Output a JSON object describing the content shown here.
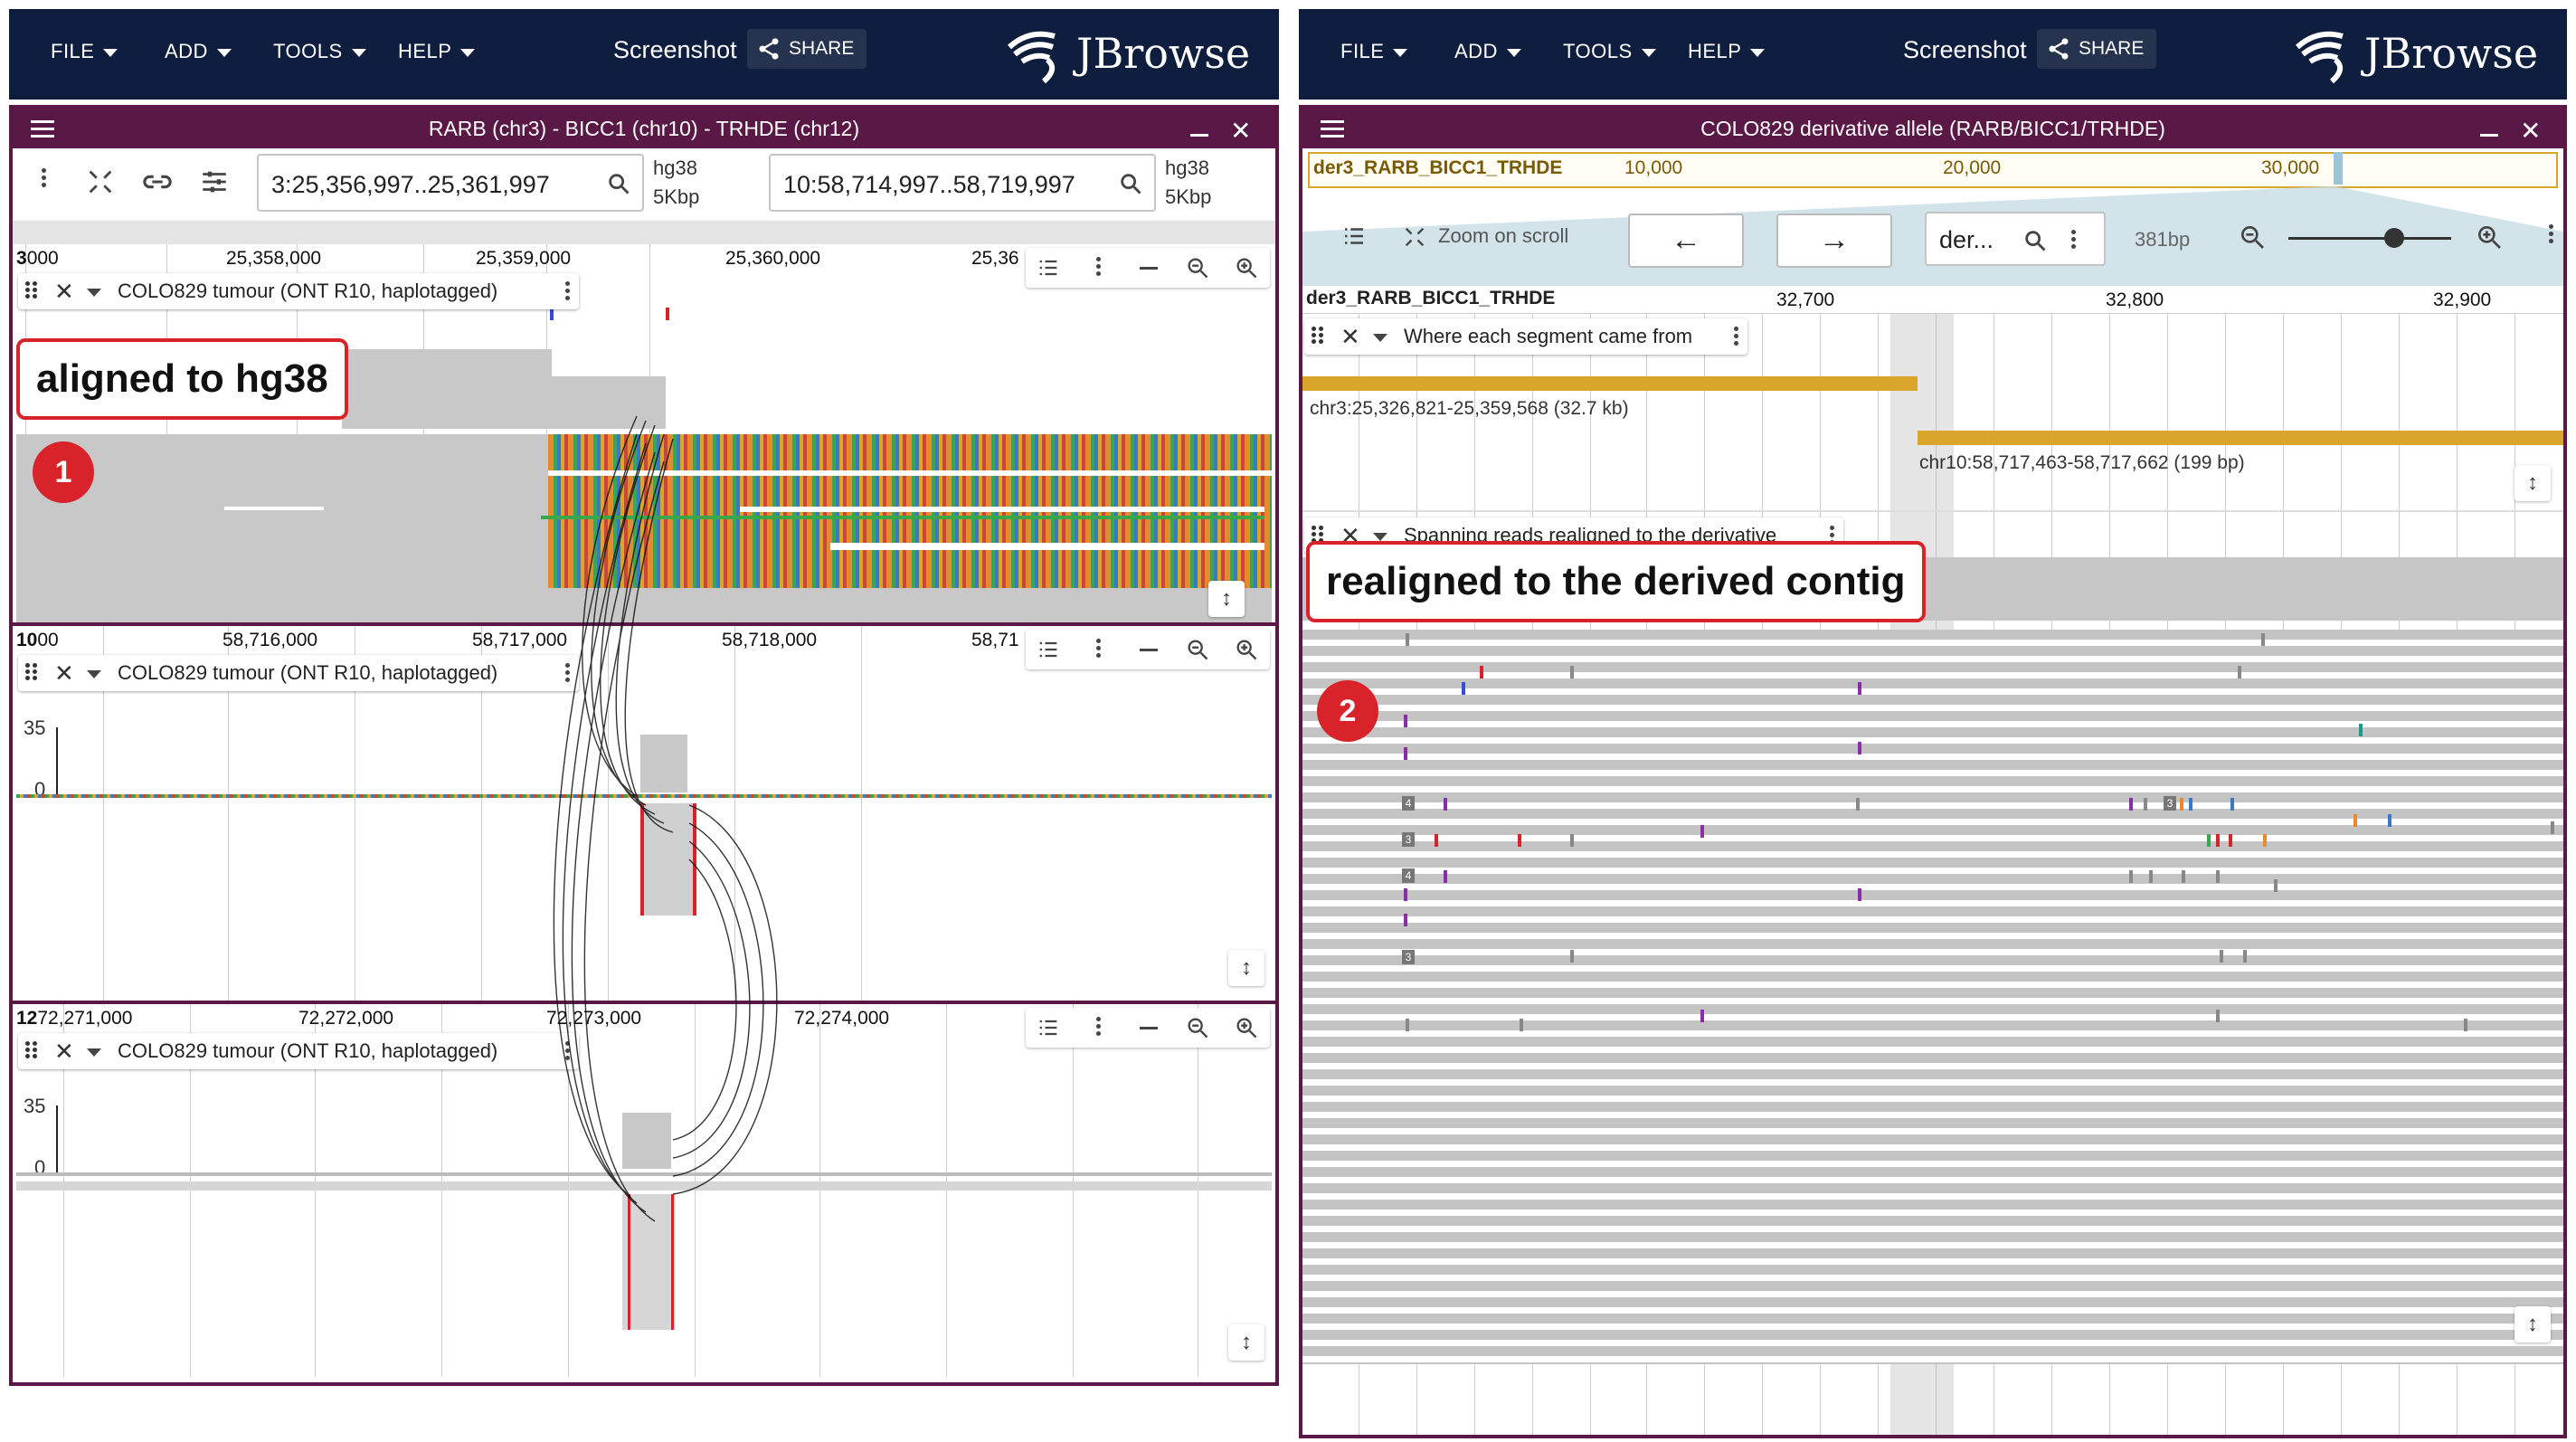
{
  "left_app": {
    "menu": [
      "FILE",
      "ADD",
      "TOOLS",
      "HELP"
    ],
    "screenshot_label": "Screenshot",
    "share_label": "SHARE",
    "logo_text": "JBrowse",
    "view_title": "RARB (chr3) - BICC1 (chr10) - TRHDE (chr12)",
    "location1": "3:25,356,997..25,361,997",
    "location2": "10:58,714,997..58,719,997",
    "assembly1": "hg38",
    "span1": "5Kbp",
    "assembly2": "hg38",
    "span2": "5Kbp",
    "panel1": {
      "ref_prefix": "3",
      "ref_first": "000",
      "ticks": [
        "25,358,000",
        "25,359,000",
        "25,360,000",
        "25,36"
      ]
    },
    "panel2": {
      "ref_prefix": "10",
      "ref_first": "00",
      "ticks": [
        "58,716,000",
        "58,717,000",
        "58,718,000",
        "58,71"
      ]
    },
    "panel3": {
      "ref_prefix": "12",
      "ref_first": "72,271,000",
      "ticks": [
        "72,272,000",
        "72,273,000",
        "72,274,000"
      ]
    },
    "track_name": "COLO829 tumour (ONT R10, haplotagged)",
    "coverage_max": "35",
    "coverage_min": "0",
    "callout": "aligned to hg38",
    "badge": "1"
  },
  "right_app": {
    "menu": [
      "FILE",
      "ADD",
      "TOOLS",
      "HELP"
    ],
    "screenshot_label": "Screenshot",
    "share_label": "SHARE",
    "logo_text": "JBrowse",
    "view_title": "COLO829 derivative allele (RARB/BICC1/TRHDE)",
    "overview_contig": "der3_RARB_BICC1_TRHDE",
    "overview_ticks": [
      "10,000",
      "20,000",
      "30,000"
    ],
    "zoom_on_scroll": "Zoom on scroll",
    "location_short": "der...",
    "bp_label": "381bp",
    "ruler_contig": "der3_RARB_BICC1_TRHDE",
    "ruler_ticks": [
      "32,700",
      "32,800",
      "32,900"
    ],
    "track1_name": "Where each segment came from",
    "segment1_label": "chr3:25,326,821-25,359,568 (32.7 kb)",
    "segment2_label": "chr10:58,717,463-58,717,662 (199 bp)",
    "track2_name": "Spanning reads realigned to the derivative",
    "callout": "realigned to the derived contig",
    "badge": "2",
    "ins_label": "4",
    "ins_label_b": "3"
  },
  "colors": {
    "topbar": "#0f1e3f",
    "view_border": "#5a1846",
    "callout": "#d9232b",
    "segment": "#d9a52b"
  }
}
